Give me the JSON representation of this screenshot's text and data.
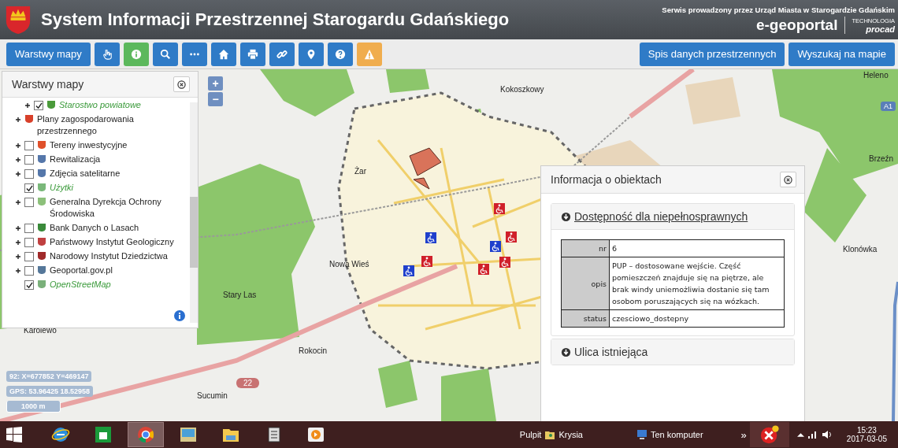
{
  "header": {
    "title": "System Informacji Przestrzennej Starogardu Gdańskiego",
    "operator": "Serwis prowadzony przez Urząd Miasta w Starogardzie Gdańskim",
    "brand": "e-geoportal",
    "tech_label": "TECHNOLOGIA",
    "tech_brand": "procad"
  },
  "toolbar": {
    "left_label": "Warstwy mapy",
    "right_labels": [
      "Spis danych przestrzennych",
      "Wyszukaj na mapie"
    ]
  },
  "layers_panel": {
    "title": "Warstwy mapy",
    "items": [
      {
        "kind": "sublayer",
        "label": "Starostwo powiatowe",
        "checked": true,
        "expandable": true
      },
      {
        "kind": "folder",
        "label": "Plany zagospodarowania przestrzennego",
        "expandable": true
      },
      {
        "kind": "layer",
        "label": "Tereny inwestycyjne",
        "checked": false,
        "expandable": true
      },
      {
        "kind": "layer",
        "label": "Rewitalizacja",
        "checked": false,
        "expandable": true
      },
      {
        "kind": "layer",
        "label": "Zdjęcia satelitarne",
        "checked": false,
        "expandable": true
      },
      {
        "kind": "layer",
        "label": "Użytki",
        "checked": true,
        "expandable": false
      },
      {
        "kind": "layer",
        "label": "Generalna Dyrekcja Ochrony Środowiska",
        "checked": false,
        "expandable": true
      },
      {
        "kind": "layer",
        "label": "Bank Danych o Lasach",
        "checked": false,
        "expandable": true
      },
      {
        "kind": "layer",
        "label": "Państwowy Instytut Geologiczny",
        "checked": false,
        "expandable": true
      },
      {
        "kind": "layer",
        "label": "Narodowy Instytut Dziedzictwa",
        "checked": false,
        "expandable": true
      },
      {
        "kind": "layer",
        "label": "Geoportal.gov.pl",
        "checked": false,
        "expandable": true
      },
      {
        "kind": "layer",
        "label": "OpenStreetMap",
        "checked": true,
        "expandable": false
      }
    ]
  },
  "map": {
    "zoom_in": "+",
    "zoom_out": "−",
    "places": [
      "Kokoszkowy",
      "Żar",
      "Nowa Wieś",
      "Stary Las",
      "Karolewo",
      "Rokocin",
      "Sucumin",
      "Heleno",
      "Brzeźn",
      "Klonówka"
    ],
    "road_badge": "22",
    "motorway_badge": "A1",
    "coords": "92: X=677852 Y=469147",
    "gps": "GPS: 53.96425 18.52958",
    "scale": "1000 m"
  },
  "info_panel": {
    "title": "Informacja o obiektach",
    "sections": [
      {
        "title": "Dostępność dla niepełnosprawnych",
        "expanded": true,
        "rows": [
          {
            "key": "nr",
            "value": "6"
          },
          {
            "key": "opis",
            "value": "PUP – dostosowane wejście. Część pomieszczeń znajduje się na piętrze, ale brak windy uniemożliwia dostanie się tam osobom poruszających się na wózkach."
          },
          {
            "key": "status",
            "value": "czesciowo_dostepny"
          }
        ]
      },
      {
        "title": "Ulica istniejąca",
        "expanded": false
      }
    ]
  },
  "taskbar": {
    "apps": [
      {
        "selected": false
      },
      {
        "selected": false
      },
      {
        "selected": true
      },
      {
        "selected": false
      },
      {
        "selected": false
      },
      {
        "selected": false
      },
      {
        "selected": false
      }
    ],
    "toolbars": [
      "Pulpit",
      "Krysia",
      "Ten komputer"
    ],
    "overflow": "»",
    "time": "15:23",
    "date": "2017-03-05"
  }
}
